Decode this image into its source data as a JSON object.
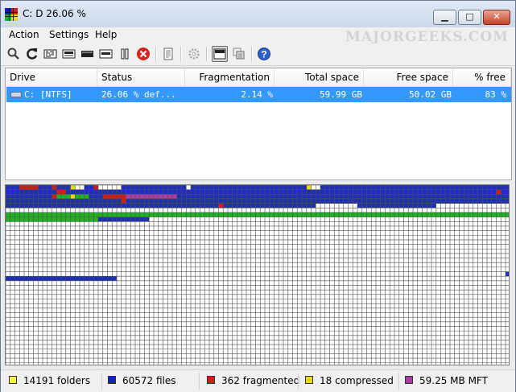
{
  "window": {
    "title": "C:  D  26.06 %"
  },
  "caption_buttons": {
    "minimize": "▁",
    "maximize": "□",
    "close": "✕"
  },
  "menu": [
    "Action",
    "Settings",
    "Help"
  ],
  "watermark": "MAJORGEEKS.COM",
  "toolbar": {
    "icons": [
      "search-icon",
      "refresh-icon",
      "defrag-icon",
      "optimize-icon",
      "pause-drive-icon",
      "hide-icon",
      "pause-icon",
      "stop-icon",
      "report-icon",
      "settings-icon",
      "map-view-icon",
      "layout-icon",
      "help-icon"
    ],
    "pressed": "map-view-icon"
  },
  "drive_list": {
    "columns": [
      "Drive",
      "Status",
      "Fragmentation",
      "Total space",
      "Free space",
      "% free"
    ],
    "rows": [
      {
        "drive": "C: [NTFS]",
        "status": "26.06 % def...",
        "fragmentation": "2.14 %",
        "total": "59.99 GB",
        "free": "50.02 GB",
        "pct_free": "83 %"
      }
    ]
  },
  "colors": {
    "selection": "#3399ff",
    "map_used": "#1d2fb5",
    "map_free": "#ffffff",
    "map_grid": "#505050",
    "system": "#1fb323",
    "fragmented": "#d21b1b",
    "compressed": "#e6d81a",
    "mft": "#a83ca8",
    "folders": "#f6f24a",
    "files": "#1122bb"
  },
  "status": [
    {
      "label": "14191 folders",
      "color": "#f6f24a"
    },
    {
      "label": "60572 files",
      "color": "#1122bb"
    },
    {
      "label": "362 fragmented",
      "color": "#d21b1b"
    },
    {
      "label": "18 compressed",
      "color": "#e6d81a"
    },
    {
      "label": "59.25 MB MFT",
      "color": "#a83ca8"
    }
  ]
}
